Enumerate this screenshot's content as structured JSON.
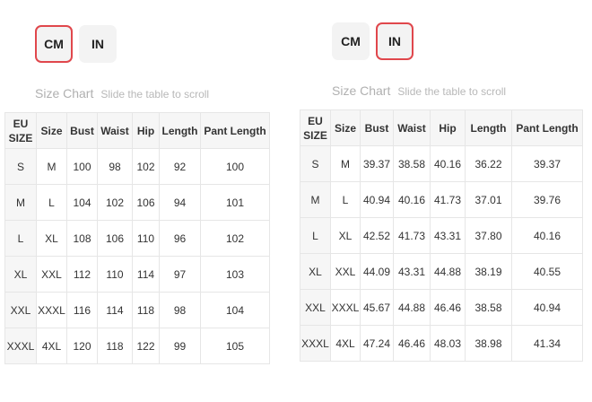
{
  "left": {
    "units": {
      "cm_label": "CM",
      "in_label": "IN",
      "active": "CM"
    },
    "title": "Size Chart",
    "hint": "Slide the table to scroll",
    "headers": {
      "eu_line1": "EU",
      "eu_line2": "SIZE",
      "size": "Size",
      "bust": "Bust",
      "waist": "Waist",
      "hip": "Hip",
      "length": "Length",
      "pant_length": "Pant Length"
    },
    "rows": [
      {
        "eu": "S",
        "size": "M",
        "bust": "100",
        "waist": "98",
        "hip": "102",
        "length": "92",
        "pant_length": "100"
      },
      {
        "eu": "M",
        "size": "L",
        "bust": "104",
        "waist": "102",
        "hip": "106",
        "length": "94",
        "pant_length": "101"
      },
      {
        "eu": "L",
        "size": "XL",
        "bust": "108",
        "waist": "106",
        "hip": "110",
        "length": "96",
        "pant_length": "102"
      },
      {
        "eu": "XL",
        "size": "XXL",
        "bust": "112",
        "waist": "110",
        "hip": "114",
        "length": "97",
        "pant_length": "103"
      },
      {
        "eu": "XXL",
        "size": "XXXL",
        "bust": "116",
        "waist": "114",
        "hip": "118",
        "length": "98",
        "pant_length": "104"
      },
      {
        "eu": "XXXL",
        "size": "4XL",
        "bust": "120",
        "waist": "118",
        "hip": "122",
        "length": "99",
        "pant_length": "105"
      }
    ]
  },
  "right": {
    "units": {
      "cm_label": "CM",
      "in_label": "IN",
      "active": "IN"
    },
    "title": "Size Chart",
    "hint": "Slide the table to scroll",
    "headers": {
      "eu_line1": "EU",
      "eu_line2": "SIZE",
      "size": "Size",
      "bust": "Bust",
      "waist": "Waist",
      "hip": "Hip",
      "length": "Length",
      "pant_length": "Pant Length"
    },
    "rows": [
      {
        "eu": "S",
        "size": "M",
        "bust": "39.37",
        "waist": "38.58",
        "hip": "40.16",
        "length": "36.22",
        "pant_length": "39.37"
      },
      {
        "eu": "M",
        "size": "L",
        "bust": "40.94",
        "waist": "40.16",
        "hip": "41.73",
        "length": "37.01",
        "pant_length": "39.76"
      },
      {
        "eu": "L",
        "size": "XL",
        "bust": "42.52",
        "waist": "41.73",
        "hip": "43.31",
        "length": "37.80",
        "pant_length": "40.16"
      },
      {
        "eu": "XL",
        "size": "XXL",
        "bust": "44.09",
        "waist": "43.31",
        "hip": "44.88",
        "length": "38.19",
        "pant_length": "40.55"
      },
      {
        "eu": "XXL",
        "size": "XXXL",
        "bust": "45.67",
        "waist": "44.88",
        "hip": "46.46",
        "length": "38.58",
        "pant_length": "40.94"
      },
      {
        "eu": "XXXL",
        "size": "4XL",
        "bust": "47.24",
        "waist": "46.46",
        "hip": "48.03",
        "length": "38.98",
        "pant_length": "41.34"
      }
    ]
  },
  "colors": {
    "active_border": "#e0474c",
    "button_bg": "#f3f3f3",
    "header_bg": "#f6f6f6",
    "muted_text": "#b0b0b0"
  }
}
